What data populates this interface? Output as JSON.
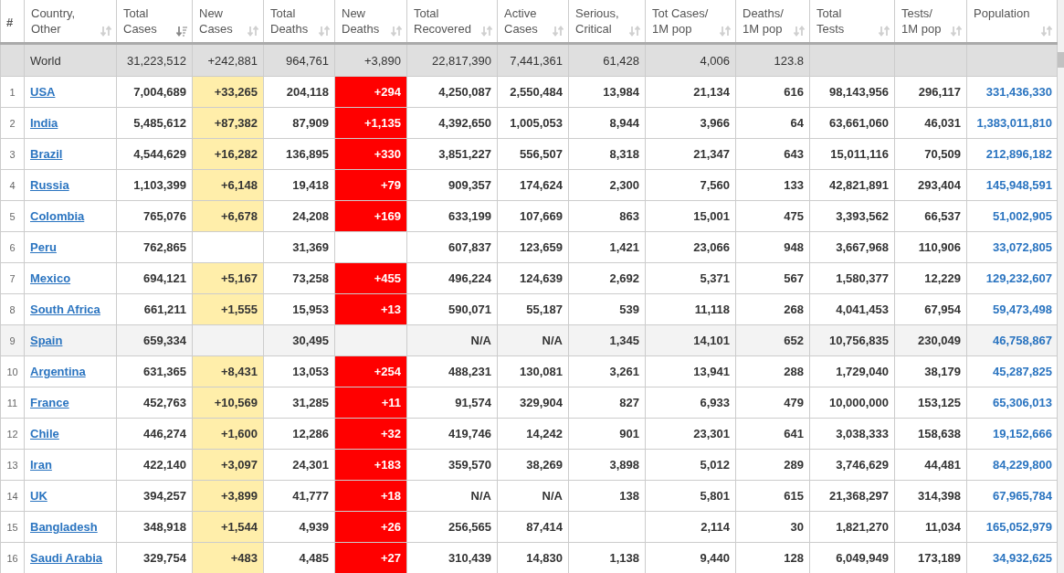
{
  "columns": [
    {
      "lines": [
        "#"
      ],
      "sortable": false
    },
    {
      "lines": [
        "Country,",
        "Other"
      ],
      "sortable": true,
      "sorted": false
    },
    {
      "lines": [
        "Total",
        "Cases"
      ],
      "sortable": true,
      "sorted": true
    },
    {
      "lines": [
        "New",
        "Cases"
      ],
      "sortable": true,
      "sorted": false
    },
    {
      "lines": [
        "Total",
        "Deaths"
      ],
      "sortable": true,
      "sorted": false
    },
    {
      "lines": [
        "New",
        "Deaths"
      ],
      "sortable": true,
      "sorted": false
    },
    {
      "lines": [
        "Total",
        "Recovered"
      ],
      "sortable": true,
      "sorted": false
    },
    {
      "lines": [
        "Active",
        "Cases"
      ],
      "sortable": true,
      "sorted": false
    },
    {
      "lines": [
        "Serious,",
        "Critical"
      ],
      "sortable": true,
      "sorted": false
    },
    {
      "lines": [
        "Tot Cases/",
        "1M pop"
      ],
      "sortable": true,
      "sorted": false
    },
    {
      "lines": [
        "Deaths/",
        "1M pop"
      ],
      "sortable": true,
      "sorted": false
    },
    {
      "lines": [
        "Total",
        "Tests"
      ],
      "sortable": true,
      "sorted": false
    },
    {
      "lines": [
        "Tests/",
        "1M pop"
      ],
      "sortable": true,
      "sorted": false
    },
    {
      "lines": [
        "Population"
      ],
      "sortable": true,
      "sorted": false
    }
  ],
  "world": {
    "country": "World",
    "total_cases": "31,223,512",
    "new_cases": "+242,881",
    "total_deaths": "964,761",
    "new_deaths": "+3,890",
    "total_recovered": "22,817,390",
    "active_cases": "7,441,361",
    "serious_critical": "61,428",
    "tot_cases_1m": "4,006",
    "deaths_1m": "123.8"
  },
  "rows": [
    {
      "rank": "1",
      "country": "USA",
      "total_cases": "7,004,689",
      "new_cases": "+33,265",
      "total_deaths": "204,118",
      "new_deaths": "+294",
      "total_recovered": "4,250,087",
      "active_cases": "2,550,484",
      "serious_critical": "13,984",
      "tot_cases_1m": "21,134",
      "deaths_1m": "616",
      "total_tests": "98,143,956",
      "tests_1m": "296,117",
      "population": "331,436,330",
      "highlighted": false
    },
    {
      "rank": "2",
      "country": "India",
      "total_cases": "5,485,612",
      "new_cases": "+87,382",
      "total_deaths": "87,909",
      "new_deaths": "+1,135",
      "total_recovered": "4,392,650",
      "active_cases": "1,005,053",
      "serious_critical": "8,944",
      "tot_cases_1m": "3,966",
      "deaths_1m": "64",
      "total_tests": "63,661,060",
      "tests_1m": "46,031",
      "population": "1,383,011,810",
      "highlighted": false
    },
    {
      "rank": "3",
      "country": "Brazil",
      "total_cases": "4,544,629",
      "new_cases": "+16,282",
      "total_deaths": "136,895",
      "new_deaths": "+330",
      "total_recovered": "3,851,227",
      "active_cases": "556,507",
      "serious_critical": "8,318",
      "tot_cases_1m": "21,347",
      "deaths_1m": "643",
      "total_tests": "15,011,116",
      "tests_1m": "70,509",
      "population": "212,896,182",
      "highlighted": false
    },
    {
      "rank": "4",
      "country": "Russia",
      "total_cases": "1,103,399",
      "new_cases": "+6,148",
      "total_deaths": "19,418",
      "new_deaths": "+79",
      "total_recovered": "909,357",
      "active_cases": "174,624",
      "serious_critical": "2,300",
      "tot_cases_1m": "7,560",
      "deaths_1m": "133",
      "total_tests": "42,821,891",
      "tests_1m": "293,404",
      "population": "145,948,591",
      "highlighted": false
    },
    {
      "rank": "5",
      "country": "Colombia",
      "total_cases": "765,076",
      "new_cases": "+6,678",
      "total_deaths": "24,208",
      "new_deaths": "+169",
      "total_recovered": "633,199",
      "active_cases": "107,669",
      "serious_critical": "863",
      "tot_cases_1m": "15,001",
      "deaths_1m": "475",
      "total_tests": "3,393,562",
      "tests_1m": "66,537",
      "population": "51,002,905",
      "highlighted": false
    },
    {
      "rank": "6",
      "country": "Peru",
      "total_cases": "762,865",
      "total_deaths": "31,369",
      "total_recovered": "607,837",
      "active_cases": "123,659",
      "serious_critical": "1,421",
      "tot_cases_1m": "23,066",
      "deaths_1m": "948",
      "total_tests": "3,667,968",
      "tests_1m": "110,906",
      "population": "33,072,805",
      "highlighted": false
    },
    {
      "rank": "7",
      "country": "Mexico",
      "total_cases": "694,121",
      "new_cases": "+5,167",
      "total_deaths": "73,258",
      "new_deaths": "+455",
      "total_recovered": "496,224",
      "active_cases": "124,639",
      "serious_critical": "2,692",
      "tot_cases_1m": "5,371",
      "deaths_1m": "567",
      "total_tests": "1,580,377",
      "tests_1m": "12,229",
      "population": "129,232,607",
      "highlighted": false
    },
    {
      "rank": "8",
      "country": "South Africa",
      "total_cases": "661,211",
      "new_cases": "+1,555",
      "total_deaths": "15,953",
      "new_deaths": "+13",
      "total_recovered": "590,071",
      "active_cases": "55,187",
      "serious_critical": "539",
      "tot_cases_1m": "11,118",
      "deaths_1m": "268",
      "total_tests": "4,041,453",
      "tests_1m": "67,954",
      "population": "59,473,498",
      "highlighted": false
    },
    {
      "rank": "9",
      "country": "Spain",
      "total_cases": "659,334",
      "total_deaths": "30,495",
      "total_recovered": "N/A",
      "active_cases": "N/A",
      "serious_critical": "1,345",
      "tot_cases_1m": "14,101",
      "deaths_1m": "652",
      "total_tests": "10,756,835",
      "tests_1m": "230,049",
      "population": "46,758,867",
      "highlighted": true
    },
    {
      "rank": "10",
      "country": "Argentina",
      "total_cases": "631,365",
      "new_cases": "+8,431",
      "total_deaths": "13,053",
      "new_deaths": "+254",
      "total_recovered": "488,231",
      "active_cases": "130,081",
      "serious_critical": "3,261",
      "tot_cases_1m": "13,941",
      "deaths_1m": "288",
      "total_tests": "1,729,040",
      "tests_1m": "38,179",
      "population": "45,287,825",
      "highlighted": false
    },
    {
      "rank": "11",
      "country": "France",
      "total_cases": "452,763",
      "new_cases": "+10,569",
      "total_deaths": "31,285",
      "new_deaths": "+11",
      "total_recovered": "91,574",
      "active_cases": "329,904",
      "serious_critical": "827",
      "tot_cases_1m": "6,933",
      "deaths_1m": "479",
      "total_tests": "10,000,000",
      "tests_1m": "153,125",
      "population": "65,306,013",
      "highlighted": false
    },
    {
      "rank": "12",
      "country": "Chile",
      "total_cases": "446,274",
      "new_cases": "+1,600",
      "total_deaths": "12,286",
      "new_deaths": "+32",
      "total_recovered": "419,746",
      "active_cases": "14,242",
      "serious_critical": "901",
      "tot_cases_1m": "23,301",
      "deaths_1m": "641",
      "total_tests": "3,038,333",
      "tests_1m": "158,638",
      "population": "19,152,666",
      "highlighted": false
    },
    {
      "rank": "13",
      "country": "Iran",
      "total_cases": "422,140",
      "new_cases": "+3,097",
      "total_deaths": "24,301",
      "new_deaths": "+183",
      "total_recovered": "359,570",
      "active_cases": "38,269",
      "serious_critical": "3,898",
      "tot_cases_1m": "5,012",
      "deaths_1m": "289",
      "total_tests": "3,746,629",
      "tests_1m": "44,481",
      "population": "84,229,800",
      "highlighted": false
    },
    {
      "rank": "14",
      "country": "UK",
      "total_cases": "394,257",
      "new_cases": "+3,899",
      "total_deaths": "41,777",
      "new_deaths": "+18",
      "total_recovered": "N/A",
      "active_cases": "N/A",
      "serious_critical": "138",
      "tot_cases_1m": "5,801",
      "deaths_1m": "615",
      "total_tests": "21,368,297",
      "tests_1m": "314,398",
      "population": "67,965,784",
      "highlighted": false
    },
    {
      "rank": "15",
      "country": "Bangladesh",
      "total_cases": "348,918",
      "new_cases": "+1,544",
      "total_deaths": "4,939",
      "new_deaths": "+26",
      "total_recovered": "256,565",
      "active_cases": "87,414",
      "tot_cases_1m": "2,114",
      "deaths_1m": "30",
      "total_tests": "1,821,270",
      "tests_1m": "11,034",
      "population": "165,052,979",
      "highlighted": false
    },
    {
      "rank": "16",
      "country": "Saudi Arabia",
      "total_cases": "329,754",
      "new_cases": "+483",
      "total_deaths": "4,485",
      "new_deaths": "+27",
      "total_recovered": "310,439",
      "active_cases": "14,830",
      "serious_critical": "1,138",
      "tot_cases_1m": "9,440",
      "deaths_1m": "128",
      "total_tests": "6,049,949",
      "tests_1m": "173,189",
      "population": "34,932,625",
      "highlighted": false
    }
  ]
}
